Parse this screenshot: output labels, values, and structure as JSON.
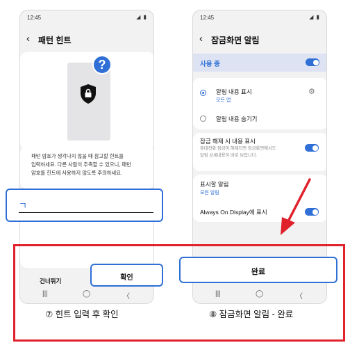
{
  "status_time": "12:45",
  "status_icons": "◢ ▮",
  "left_screen": {
    "title": "패턴 힌트",
    "description_lines": [
      "패턴 암호가 생각나지 않을 때 참고할 힌트를",
      "입력하세요. 다른 사람이 추측할 수 있으니, 패턴",
      "암호를 힌트에 사용하지 않도록 주의하세요."
    ],
    "input_value": "ㄱ",
    "skip_label": "건너뛰기",
    "confirm_label": "확인",
    "question_mark": "?"
  },
  "right_screen": {
    "title": "잠금화면 알림",
    "master_label": "사용 중",
    "option_show_label": "알림 내용 표시",
    "option_show_sub": "모든 앱",
    "option_hide_label": "알림 내용 숨기기",
    "unlock_label": "잠금 해제 시 내용 표시",
    "unlock_desc_lines": [
      "휴대전화 잠금이 해제되면 잠금화면에서도",
      "알림 상세내용이 바로 보입니다."
    ],
    "notify_label": "표시할 알림",
    "notify_sub": "모든 알림",
    "aod_label": "Always On Display에 표시",
    "done_label": "완료"
  },
  "nav": {
    "recent": "|||",
    "home": "◯",
    "back": "〈"
  },
  "captions": {
    "left": "⑦ 힌트 입력 후 확인",
    "right": "⑧ 잠금화면 알림 - 완료"
  },
  "colors": {
    "accent": "#2f6fd6",
    "annotation_red": "#e0202a"
  }
}
